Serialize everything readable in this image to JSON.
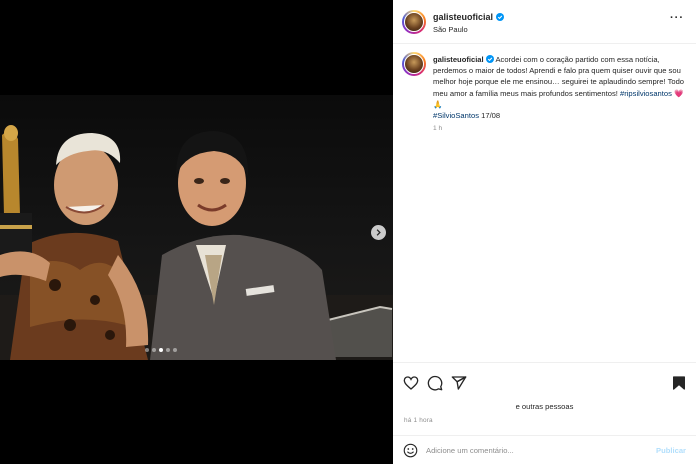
{
  "post": {
    "username": "galisteuoficial",
    "location": "São Paulo",
    "more_label": "···",
    "caption": {
      "text_1": "Acordei com o coração partido com essa notícia, perdemos o maior de todos! Aprendi e falo pra quem quiser ouvir que sou melhor hoje porque ele me ensinou… seguirei te aplaudindo sempre! Todo meu amor a família meus mais profundos sentimentos! ",
      "hashtag_1": "#ripsilviosantos",
      "emoji": "💗🙏",
      "hashtag_2": "#SilvioSantos",
      "date": " 17/08",
      "time_ago": "1 h"
    },
    "likes_text": "e outras pessoas",
    "posted_ago": "há 1 hora",
    "comment": {
      "placeholder": "Adicione um comentário...",
      "publish_label": "Publicar"
    },
    "carousel": {
      "slide_count": 5,
      "active_index": 2
    }
  },
  "colors": {
    "accent_link": "#00376b",
    "publish_disabled": "#b2dffc",
    "like_heart": "#ed4956",
    "verified_badge": "#0095f6"
  },
  "icons": {
    "like": "heart-icon",
    "comment": "comment-icon",
    "share": "share-icon",
    "save": "bookmark-icon",
    "emoji": "emoji-icon",
    "next": "chevron-right-icon",
    "verified": "verified-badge-icon"
  }
}
